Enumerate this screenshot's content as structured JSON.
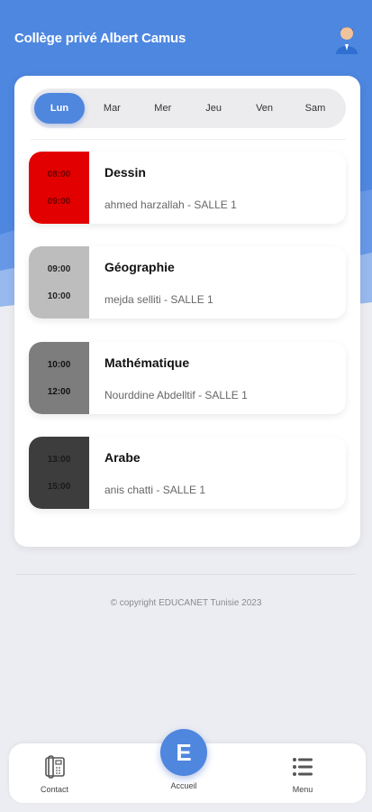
{
  "header": {
    "title": "Collège privé Albert Camus"
  },
  "days": [
    {
      "label": "Lun",
      "active": true
    },
    {
      "label": "Mar",
      "active": false
    },
    {
      "label": "Mer",
      "active": false
    },
    {
      "label": "Jeu",
      "active": false
    },
    {
      "label": "Ven",
      "active": false
    },
    {
      "label": "Sam",
      "active": false
    }
  ],
  "lessons": [
    {
      "start": "08:00",
      "end": "09:00",
      "subject": "Dessin",
      "teacher": "ahmed harzallah - SALLE 1",
      "color": "#e30000",
      "text_color": "#6a0000"
    },
    {
      "start": "09:00",
      "end": "10:00",
      "subject": "Géographie",
      "teacher": "mejda selliti - SALLE 1",
      "color": "#bdbdbd",
      "text_color": "#222222"
    },
    {
      "start": "10:00",
      "end": "12:00",
      "subject": "Mathématique",
      "teacher": "Nourddine Abdelltif - SALLE 1",
      "color": "#7d7d7d",
      "text_color": "#111111"
    },
    {
      "start": "13:00",
      "end": "15:00",
      "subject": "Arabe",
      "teacher": "anis chatti - SALLE 1",
      "color": "#3d3d3d",
      "text_color": "#1a1a1a"
    }
  ],
  "footer": {
    "copyright": "© copyright EDUCANET Tunisie 2023"
  },
  "bottom_nav": {
    "contact": {
      "label": "Contact",
      "icon": "phone-icon"
    },
    "home": {
      "label": "Accueil",
      "icon": "e-logo-icon",
      "glyph": "E"
    },
    "menu": {
      "label": "Menu",
      "icon": "list-menu-icon"
    }
  },
  "colors": {
    "primary": "#4f86de",
    "header_bg": "#4e87e0",
    "background": "#ecedf2"
  }
}
